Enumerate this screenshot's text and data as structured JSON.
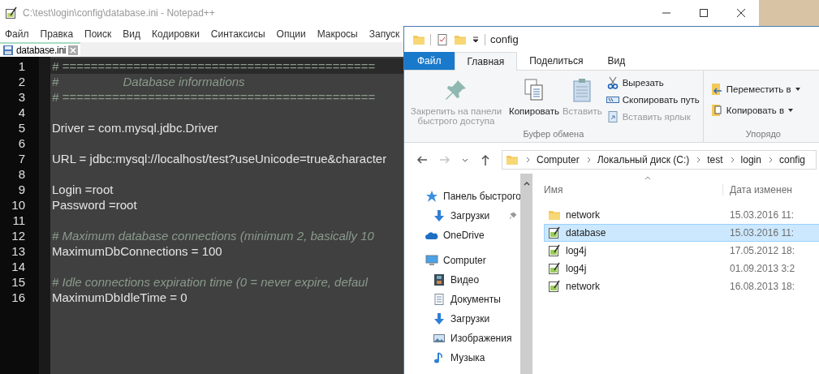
{
  "notepad": {
    "title": "C:\\test\\login\\config\\database.ini - Notepad++",
    "menu": [
      "Файл",
      "Правка",
      "Поиск",
      "Вид",
      "Кодировки",
      "Синтаксисы",
      "Опции",
      "Макросы",
      "Запуск"
    ],
    "tabs": [
      {
        "label": "database.ini",
        "selected": true
      }
    ],
    "lines": [
      {
        "number": "1",
        "kind": "comment",
        "current": true,
        "text": "# ============================================"
      },
      {
        "number": "2",
        "kind": "comment",
        "current": false,
        "text": "#                   Database informations"
      },
      {
        "number": "3",
        "kind": "comment",
        "current": false,
        "text": "# ============================================"
      },
      {
        "number": "4",
        "kind": "blank",
        "current": false
      },
      {
        "number": "5",
        "kind": "code",
        "current": false,
        "text": "Driver = com.mysql.jdbc.Driver"
      },
      {
        "number": "6",
        "kind": "blank",
        "current": false
      },
      {
        "number": "7",
        "kind": "code",
        "current": false,
        "text": "URL = jdbc:mysql://localhost/test?useUnicode=true&character"
      },
      {
        "number": "8",
        "kind": "blank",
        "current": false
      },
      {
        "number": "9",
        "kind": "code",
        "current": false,
        "text": "Login =root"
      },
      {
        "number": "10",
        "kind": "code",
        "current": false,
        "text": "Password =root"
      },
      {
        "number": "11",
        "kind": "blank",
        "current": false
      },
      {
        "number": "12",
        "kind": "comment",
        "current": false,
        "text": "# Maximum database connections (minimum 2, basically 10"
      },
      {
        "number": "13",
        "kind": "code",
        "current": false,
        "text": "MaximumDbConnections = 100"
      },
      {
        "number": "14",
        "kind": "blank",
        "current": false
      },
      {
        "number": "15",
        "kind": "comment",
        "current": false,
        "text": "# Idle connections expiration time (0 = never expire, defaul"
      },
      {
        "number": "16",
        "kind": "code",
        "current": false,
        "text": "MaximumDbIdleTime = 0"
      }
    ]
  },
  "explorer": {
    "title": "config",
    "ribbon_tabs": [
      {
        "label": "Файл",
        "kind": "file",
        "selected": false
      },
      {
        "label": "Главная",
        "kind": "tab",
        "selected": true
      },
      {
        "label": "Поделиться",
        "kind": "tab",
        "selected": false
      },
      {
        "label": "Вид",
        "kind": "tab",
        "selected": false
      }
    ],
    "clipboard_group": {
      "label": "Буфер обмена",
      "large": [
        {
          "label": "Закрепить на панели быстрого доступа",
          "kind": "pin",
          "disabled": true
        },
        {
          "label": "Копировать",
          "kind": "copy",
          "disabled": false
        },
        {
          "label": "Вставить",
          "kind": "paste",
          "disabled": true
        }
      ],
      "small": [
        {
          "label": "Вырезать",
          "kind": "cut",
          "disabled": false
        },
        {
          "label": "Скопировать путь",
          "kind": "path",
          "disabled": false
        },
        {
          "label": "Вставить ярлык",
          "kind": "shortcut",
          "disabled": true
        }
      ]
    },
    "organize_group": {
      "label": "Упорядо",
      "buttons": [
        {
          "label": "Переместить в",
          "kind": "move"
        },
        {
          "label": "Копировать в",
          "kind": "copyto"
        }
      ]
    },
    "nav_buttons": [
      {
        "kind": "back",
        "disabled": false
      },
      {
        "kind": "forward",
        "disabled": true
      },
      {
        "kind": "recent",
        "disabled": false
      },
      {
        "kind": "up",
        "disabled": false
      }
    ],
    "breadcrumbs": [
      "Computer",
      "Локальный диск (C:)",
      "test",
      "login",
      "config"
    ],
    "sidebar": {
      "items": [
        {
          "label": "Панель быстрого",
          "kind": "star",
          "pinned": false,
          "children": [
            {
              "label": "Загрузки",
              "kind": "download",
              "pinned": true
            }
          ]
        },
        {
          "label": "OneDrive",
          "kind": "cloud",
          "pinned": false
        },
        {
          "label": "Computer",
          "kind": "computer",
          "pinned": false,
          "children": [
            {
              "label": "Видео",
              "kind": "video",
              "pinned": false
            },
            {
              "label": "Документы",
              "kind": "document",
              "pinned": false
            },
            {
              "label": "Загрузки",
              "kind": "download",
              "pinned": false
            },
            {
              "label": "Изображения",
              "kind": "image",
              "pinned": false
            },
            {
              "label": "Музыка",
              "kind": "music",
              "pinned": false
            }
          ]
        }
      ]
    },
    "columns": [
      "Имя",
      "Дата изменен"
    ],
    "files": [
      {
        "name": "network",
        "date": "15.03.2016 11:",
        "kind": "folder",
        "selected": false
      },
      {
        "name": "database",
        "date": "15.03.2016 11:",
        "kind": "file",
        "selected": true
      },
      {
        "name": "log4j",
        "date": "17.05.2012 18:",
        "kind": "file",
        "selected": false
      },
      {
        "name": "log4j",
        "date": "01.09.2013 3:2",
        "kind": "file",
        "selected": false
      },
      {
        "name": "network",
        "date": "16.08.2013 18:",
        "kind": "file",
        "selected": false
      }
    ]
  }
}
